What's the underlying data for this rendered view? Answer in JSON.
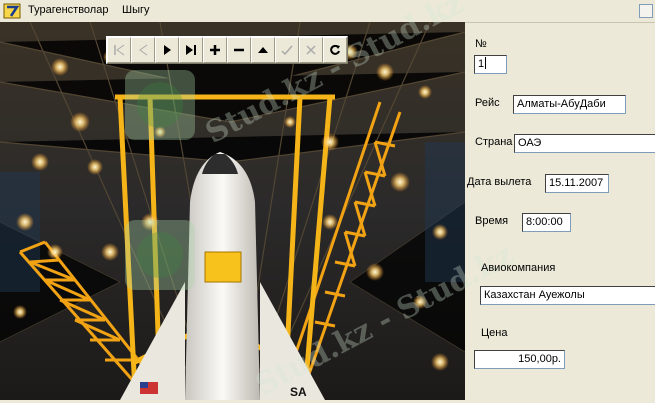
{
  "menu": {
    "items": [
      {
        "label": "Турагенстволар"
      },
      {
        "label": "Шыгу"
      }
    ]
  },
  "navigator": {
    "buttons": [
      {
        "icon": "first-record-icon",
        "enabled": false
      },
      {
        "icon": "prior-record-icon",
        "enabled": false
      },
      {
        "icon": "next-record-icon",
        "enabled": true
      },
      {
        "icon": "last-record-icon",
        "enabled": true
      },
      {
        "icon": "insert-record-icon",
        "enabled": true
      },
      {
        "icon": "delete-record-icon",
        "enabled": true
      },
      {
        "icon": "edit-record-icon",
        "enabled": true
      },
      {
        "icon": "post-edit-icon",
        "enabled": false
      },
      {
        "icon": "cancel-edit-icon",
        "enabled": false
      },
      {
        "icon": "refresh-icon",
        "enabled": true
      }
    ]
  },
  "form": {
    "number": {
      "label": "№",
      "value": "1"
    },
    "flight": {
      "label": "Рейс",
      "value": "Алматы-АбуДаби"
    },
    "country": {
      "label": "Страна",
      "value": "ОАЭ"
    },
    "departure_date": {
      "label": "Дата вылета",
      "value": "15.11.2007"
    },
    "time": {
      "label": "Время",
      "value": "8:00:00"
    },
    "airline": {
      "label": "Авиокомпания",
      "value": "Казахстан Ауежолы"
    },
    "price": {
      "label": "Цена",
      "value": "150,00р."
    }
  },
  "watermark": {
    "text": "Stud.kz - Stud.kz"
  },
  "colors": {
    "window_bg": "#ece9d8",
    "field_border": "#7f9db9",
    "menu_highlight": "#316ac5"
  }
}
